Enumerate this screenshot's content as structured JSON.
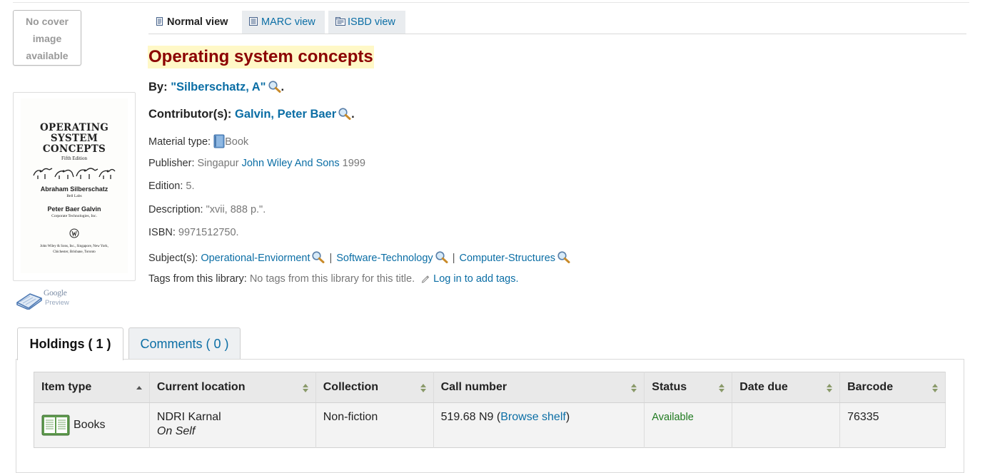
{
  "cover": {
    "no_cover_text": "No cover image available",
    "book": {
      "title_lines": [
        "OPERATING",
        "SYSTEM",
        "CONCEPTS"
      ],
      "edition": "Fifth Edition",
      "author1": "Abraham Silberschatz",
      "author1_affil": "Bell Labs",
      "author2": "Peter Baer Galvin",
      "author2_affil": "Corporate Technologies, Inc.",
      "publisher_line1": "John Wiley & Sons, Inc., Singapore, New York,",
      "publisher_line2": "Chichester, Brisbane, Toronto"
    },
    "google_preview": {
      "google": "Google",
      "preview": "Preview"
    }
  },
  "view_tabs": [
    {
      "label": "Normal view",
      "icon": "document-icon",
      "active": true
    },
    {
      "label": "MARC view",
      "icon": "list-icon",
      "active": false
    },
    {
      "label": "ISBD view",
      "icon": "isbd-icon",
      "active": false
    }
  ],
  "record": {
    "title": "Operating system concepts",
    "by_label": "By:",
    "author": "\"Silberschatz, A\"",
    "contributors_label": "Contributor(s):",
    "contributor": "Galvin, Peter Baer",
    "material_type_label": "Material type:",
    "material_type": "Book",
    "publisher_label": "Publisher:",
    "publisher_place": "Singapur",
    "publisher_name": "John Wiley And Sons",
    "publisher_year": "1999",
    "edition_label": "Edition:",
    "edition": "5.",
    "description_label": "Description:",
    "description": "\"xvii, 888 p.\".",
    "isbn_label": "ISBN:",
    "isbn": "9971512750.",
    "subjects_label": "Subject(s):",
    "subjects": [
      "Operational-Enviorment",
      "Software-Technology",
      "Computer-Structures"
    ],
    "subject_separator": "|",
    "tags_label": "Tags from this library:",
    "tags_value": "No tags from this library for this title.",
    "tags_login": "Log in to add tags."
  },
  "holdings_tabs": [
    {
      "label": "Holdings ( 1 )",
      "active": true
    },
    {
      "label": "Comments ( 0 )",
      "active": false
    }
  ],
  "holdings": {
    "columns": [
      "Item type",
      "Current location",
      "Collection",
      "Call number",
      "Status",
      "Date due",
      "Barcode"
    ],
    "rows": [
      {
        "item_type": "Books",
        "location": "NDRI Karnal",
        "sublocation": "On Self",
        "collection": "Non-fiction",
        "call_number": "519.68 N9",
        "browse_open": "(",
        "browse_link": "Browse shelf",
        "browse_close": ")",
        "status": "Available",
        "date_due": "",
        "barcode": "76335"
      }
    ]
  },
  "colors": {
    "title": "#8b0000",
    "title_highlight": "#fff8c7",
    "link": "#0b6ea5",
    "available": "#1f7a1f"
  }
}
